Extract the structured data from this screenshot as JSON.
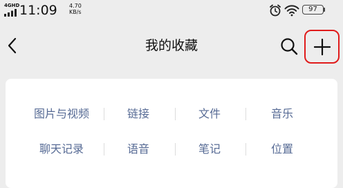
{
  "status_bar": {
    "network": "4GHD",
    "time": "11:09",
    "speed_value": "4.70",
    "speed_unit": "KB/s",
    "battery": "97",
    "icons": [
      "signal-icon",
      "alarm-icon",
      "wifi-icon",
      "battery-icon"
    ]
  },
  "nav": {
    "title": "我的收藏",
    "icons": [
      "back-icon",
      "search-icon",
      "plus-icon"
    ]
  },
  "categories": {
    "row1": [
      "图片与视频",
      "链接",
      "文件",
      "音乐"
    ],
    "row2": [
      "聊天记录",
      "语音",
      "笔记",
      "位置"
    ]
  },
  "colors": {
    "background": "#ededed",
    "card": "#ffffff",
    "link": "#576b95",
    "highlight": "#e01b1b"
  }
}
